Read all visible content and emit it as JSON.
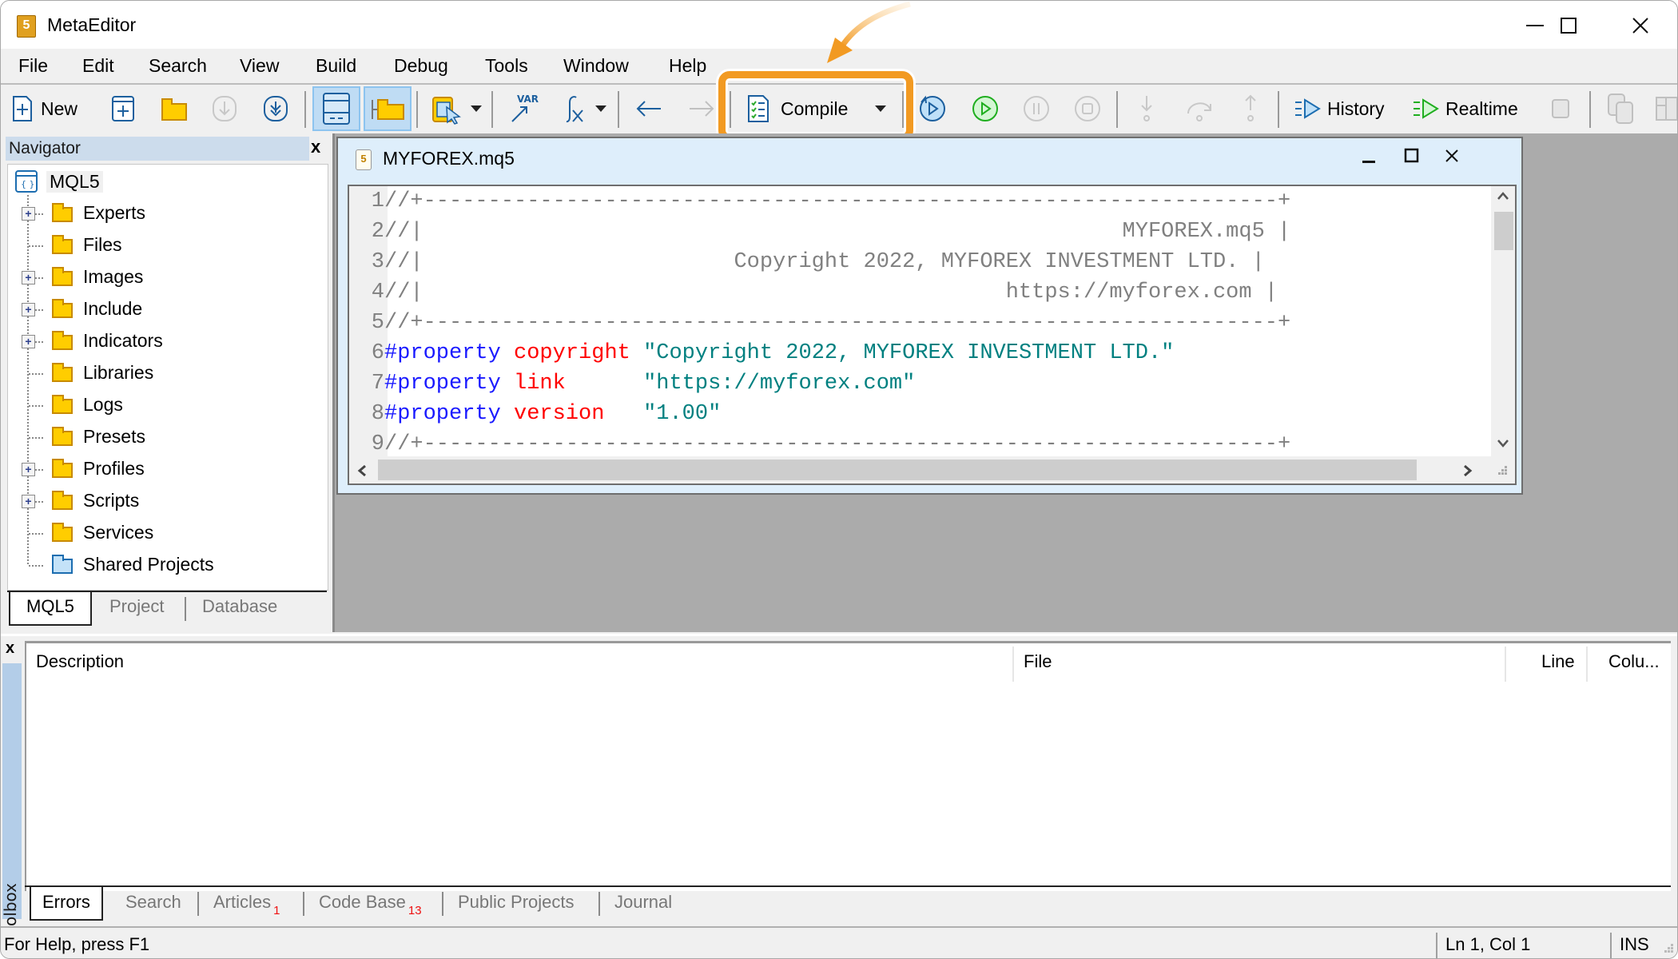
{
  "window": {
    "title": "MetaEditor",
    "controls": {
      "minimize": "–",
      "maximize": "☐",
      "close": "✕"
    }
  },
  "menu": [
    "File",
    "Edit",
    "Search",
    "View",
    "Build",
    "Debug",
    "Tools",
    "Window",
    "Help"
  ],
  "toolbar": {
    "new_label": "New",
    "compile_label": "Compile",
    "history_label": "History",
    "realtime_label": "Realtime",
    "var_label": "VAR",
    "fx_label": "fx",
    "highlight_color": "#f29a22"
  },
  "navigator": {
    "title": "Navigator",
    "close": "x",
    "root": "MQL5",
    "items": [
      {
        "label": "Experts",
        "expandable": true
      },
      {
        "label": "Files",
        "expandable": false
      },
      {
        "label": "Images",
        "expandable": true
      },
      {
        "label": "Include",
        "expandable": true
      },
      {
        "label": "Indicators",
        "expandable": true
      },
      {
        "label": "Libraries",
        "expandable": false
      },
      {
        "label": "Logs",
        "expandable": false
      },
      {
        "label": "Presets",
        "expandable": false
      },
      {
        "label": "Profiles",
        "expandable": true
      },
      {
        "label": "Scripts",
        "expandable": true
      },
      {
        "label": "Services",
        "expandable": false
      },
      {
        "label": "Shared Projects",
        "expandable": false
      }
    ],
    "tabs": [
      "MQL5",
      "Project",
      "Database"
    ],
    "active_tab": "MQL5"
  },
  "editor": {
    "title": "MYFOREX.mq5",
    "icon_glyph": "5",
    "lines": [
      {
        "n": "1",
        "parts": [
          {
            "cls": "c-com",
            "t": "//+------------------------------------------------------------------+"
          }
        ]
      },
      {
        "n": "2",
        "parts": [
          {
            "cls": "c-com",
            "t": "//|                                                      MYFOREX.mq5 |"
          }
        ]
      },
      {
        "n": "3",
        "parts": [
          {
            "cls": "c-com",
            "t": "//|                        Copyright 2022, MYFOREX INVESTMENT LTD. |"
          }
        ]
      },
      {
        "n": "4",
        "parts": [
          {
            "cls": "c-com",
            "t": "//|                                             https://myforex.com |"
          }
        ]
      },
      {
        "n": "5",
        "parts": [
          {
            "cls": "c-com",
            "t": "//+------------------------------------------------------------------+"
          }
        ]
      },
      {
        "n": "6",
        "parts": [
          {
            "cls": "c-kw",
            "t": "#property"
          },
          {
            "cls": "",
            "t": " "
          },
          {
            "cls": "c-prop",
            "t": "copyright"
          },
          {
            "cls": "",
            "t": " "
          },
          {
            "cls": "c-str",
            "t": "\"Copyright 2022, MYFOREX INVESTMENT LTD.\""
          }
        ]
      },
      {
        "n": "7",
        "parts": [
          {
            "cls": "c-kw",
            "t": "#property"
          },
          {
            "cls": "",
            "t": " "
          },
          {
            "cls": "c-prop",
            "t": "link"
          },
          {
            "cls": "",
            "t": "      "
          },
          {
            "cls": "c-str",
            "t": "\"https://myforex.com\""
          }
        ]
      },
      {
        "n": "8",
        "parts": [
          {
            "cls": "c-kw",
            "t": "#property"
          },
          {
            "cls": "",
            "t": " "
          },
          {
            "cls": "c-prop",
            "t": "version"
          },
          {
            "cls": "",
            "t": "   "
          },
          {
            "cls": "c-str",
            "t": "\"1.00\""
          }
        ]
      },
      {
        "n": "9",
        "parts": [
          {
            "cls": "c-com",
            "t": "//+------------------------------------------------------------------+"
          }
        ]
      }
    ]
  },
  "toolbox": {
    "side_label": "Toolbox",
    "close": "x",
    "columns": [
      "Description",
      "File",
      "Line",
      "Colu..."
    ],
    "tabs": [
      {
        "label": "Errors",
        "badge": ""
      },
      {
        "label": "Search",
        "badge": ""
      },
      {
        "label": "Articles",
        "badge": "1"
      },
      {
        "label": "Code Base",
        "badge": "13"
      },
      {
        "label": "Public Projects",
        "badge": ""
      },
      {
        "label": "Journal",
        "badge": ""
      }
    ],
    "active_tab": "Errors"
  },
  "status": {
    "help": "For Help, press F1",
    "position": "Ln 1, Col 1",
    "mode": "INS"
  }
}
